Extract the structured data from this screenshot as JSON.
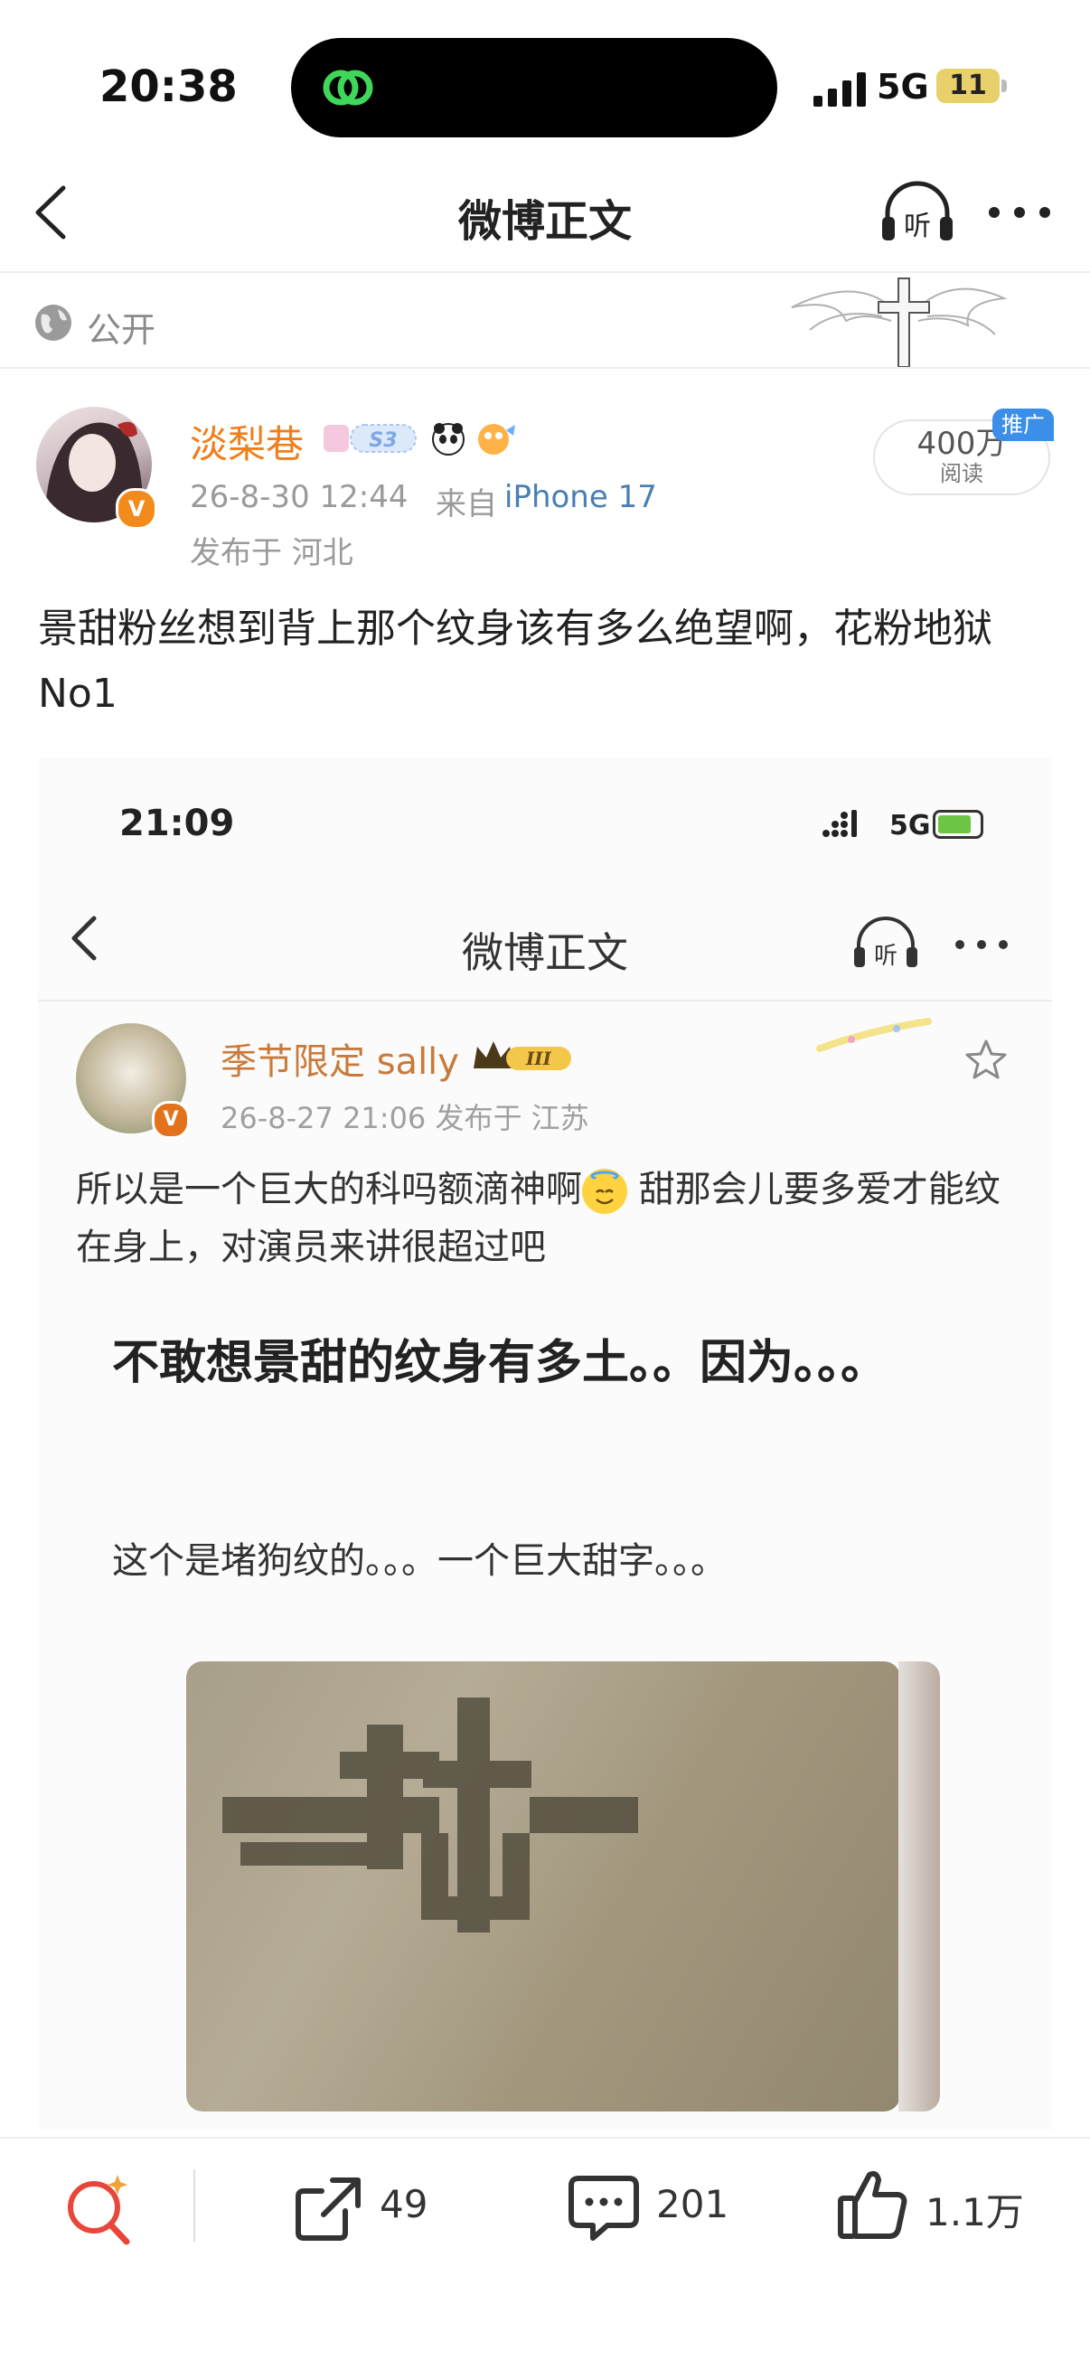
{
  "status_bar": {
    "time": "20:38",
    "network": "5G",
    "battery": "11"
  },
  "nav": {
    "title": "微博正文",
    "listen_label": "听"
  },
  "visibility": {
    "label": "公开"
  },
  "post": {
    "username": "淡梨巷",
    "user_badge_level": "S3",
    "time": "26-8-30 12:44",
    "source_prefix": "来自",
    "source_device": "iPhone 17",
    "location": "发布于 河北",
    "reads_count": "400万",
    "reads_label": "阅读",
    "ad_tag": "推广",
    "text": "景甜粉丝想到背上那个纹身该有多么绝望啊，花粉地狱No1"
  },
  "embedded": {
    "time": "21:09",
    "network": "5G",
    "title": "微博正文",
    "listen_label": "听",
    "username": "季节限定 sally",
    "crown_level": "III",
    "meta": "26-8-27 21:06  发布于 江苏",
    "text_part1": "所以是一个巨大的科吗额滴神啊",
    "text_part2": " 甜那会儿要多爱才能纹在身上，对演员来讲很超过吧",
    "heading": "不敢想景甜的纹身有多土。。因为。。。",
    "subtext": "这个是堵狗纹的。。。一个巨大甜字。。。"
  },
  "actions": {
    "share_count": "49",
    "comment_count": "201",
    "like_count": "1.1万"
  },
  "colors": {
    "username": "#f07e1c",
    "link": "#4a7fb5",
    "ad": "#3b8fe8",
    "search_accent": "#e8463a"
  },
  "icons": [
    "back-icon",
    "listen-icon",
    "more-icon",
    "globe-icon",
    "share-icon",
    "comment-icon",
    "like-icon",
    "search-icon"
  ]
}
